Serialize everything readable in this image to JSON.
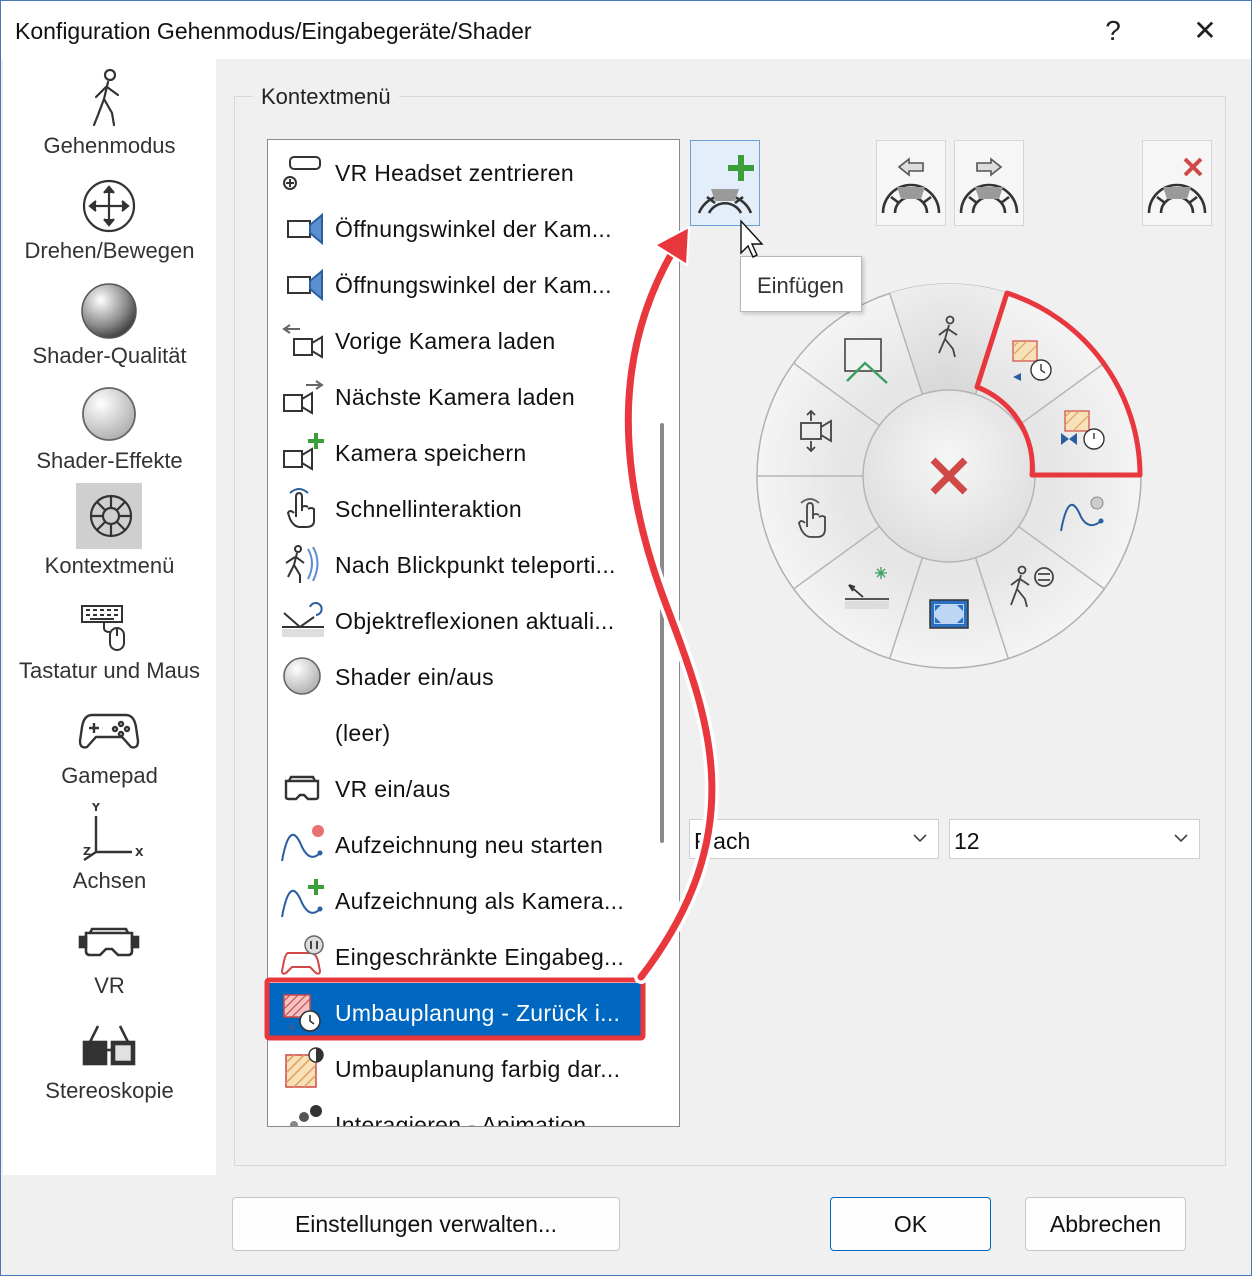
{
  "window": {
    "title": "Konfiguration Gehenmodus/Eingabegeräte/Shader",
    "help_label": "?",
    "close_label": "✕"
  },
  "sidebar": {
    "items": [
      {
        "label": "Gehenmodus",
        "icon": "walking-person-icon"
      },
      {
        "label": "Drehen/Bewegen",
        "icon": "move-arrows-icon"
      },
      {
        "label": "Shader-Qualität",
        "icon": "shaded-sphere-icon"
      },
      {
        "label": "Shader-Effekte",
        "icon": "plain-sphere-icon"
      },
      {
        "label": "Kontextmenü",
        "icon": "radial-menu-icon",
        "selected": true
      },
      {
        "label": "Tastatur und Maus",
        "icon": "keyboard-mouse-icon"
      },
      {
        "label": "Gamepad",
        "icon": "gamepad-icon"
      },
      {
        "label": "Achsen",
        "icon": "axes-icon",
        "axis_y": "Y",
        "axis_x": "X",
        "axis_z": "Z"
      },
      {
        "label": "VR",
        "icon": "vr-headset-icon"
      },
      {
        "label": "Stereoskopie",
        "icon": "3d-glasses-icon"
      }
    ]
  },
  "group": {
    "title": "Kontextmenü"
  },
  "list": {
    "items": [
      {
        "label": "VR Headset zentrieren",
        "icon": "vr-center-icon"
      },
      {
        "label": "Öffnungswinkel der Kam...",
        "icon": "camera-zoom-in-icon"
      },
      {
        "label": "Öffnungswinkel der Kam...",
        "icon": "camera-zoom-out-icon"
      },
      {
        "label": "Vorige Kamera laden",
        "icon": "camera-previous-icon"
      },
      {
        "label": "Nächste Kamera laden",
        "icon": "camera-next-icon"
      },
      {
        "label": "Kamera speichern",
        "icon": "camera-save-icon"
      },
      {
        "label": "Schnellinteraktion",
        "icon": "hand-touch-icon"
      },
      {
        "label": "Nach Blickpunkt teleporti...",
        "icon": "teleport-icon"
      },
      {
        "label": "Objektreflexionen aktuali...",
        "icon": "reflection-refresh-icon"
      },
      {
        "label": "Shader ein/aus",
        "icon": "sphere-icon"
      },
      {
        "label": "(leer)",
        "icon": ""
      },
      {
        "label": "VR ein/aus",
        "icon": "vr-headset-icon"
      },
      {
        "label": "Aufzeichnung neu starten",
        "icon": "recording-restart-icon"
      },
      {
        "label": "Aufzeichnung als Kamera...",
        "icon": "recording-camera-icon"
      },
      {
        "label": "Eingeschränkte Eingabeg...",
        "icon": "gamepad-pause-icon"
      },
      {
        "label": "Umbauplanung - Zurück i...",
        "icon": "renovation-back-icon",
        "selected": true
      },
      {
        "label": "Umbauplanung farbig dar...",
        "icon": "renovation-color-icon"
      },
      {
        "label": "Interagieren - Animation",
        "icon": "interact-animation-icon"
      }
    ]
  },
  "toolbar": {
    "insert": {
      "icon": "insert-segment-icon",
      "tooltip": "Einfügen"
    },
    "move_left": {
      "icon": "move-segment-left-icon"
    },
    "move_right": {
      "icon": "move-segment-right-icon"
    },
    "delete": {
      "icon": "delete-segment-icon"
    }
  },
  "radial_menu": {
    "center_icon": "close-x-icon",
    "segments": [
      {
        "icon": "walk-mode-icon",
        "state": "pressed"
      },
      {
        "icon": "renovation-back-icon",
        "highlighted": true
      },
      {
        "icon": "renovation-forward-icon",
        "highlighted": true
      },
      {
        "icon": "recording-restart-icon"
      },
      {
        "icon": "walk-settings-icon"
      },
      {
        "icon": "fullscreen-icon"
      },
      {
        "icon": "teleport-icon"
      },
      {
        "icon": "hand-touch-icon"
      },
      {
        "icon": "camera-move-icon"
      },
      {
        "icon": "zoom-extents-icon"
      }
    ]
  },
  "options": {
    "style_value": "Flach",
    "count_value": "12"
  },
  "buttons": {
    "manage": "Einstellungen verwalten...",
    "ok": "OK",
    "cancel": "Abbrechen"
  },
  "colors": {
    "accent": "#0067c0",
    "annotation": "#e8373d",
    "selection": "#0067c0"
  }
}
